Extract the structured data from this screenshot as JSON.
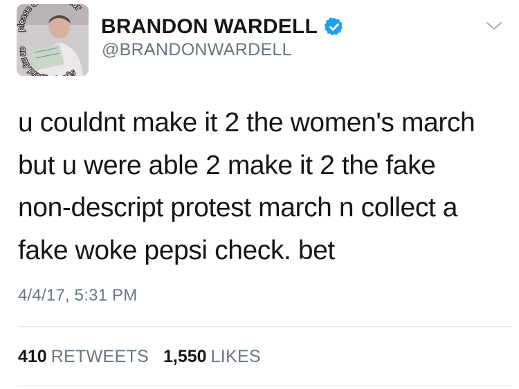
{
  "user": {
    "display_name": "BRANDON WARDELL",
    "handle": "@BRANDONWARDELL",
    "avatar_caption_top": "please do not swear",
    "avatar_caption_bottom": "on my profile thanks"
  },
  "tweet": {
    "lines": [
      "u couldnt make it 2 the women's march",
      "but u were able 2 make it 2 the fake",
      "non-descript protest march n collect a",
      "fake woke pepsi check. bet"
    ],
    "timestamp": "4/4/17, 5:31 PM"
  },
  "stats": {
    "retweets_count": "410",
    "retweets_label": "RETWEETS",
    "likes_count": "1,550",
    "likes_label": "LIKES"
  },
  "icons": {
    "verified": "verified-badge-icon",
    "menu": "chevron-down-icon"
  },
  "colors": {
    "verified": "#1da1f2",
    "secondary_text": "#657786",
    "primary_text": "#14171a",
    "divider": "#e1e8ed"
  }
}
